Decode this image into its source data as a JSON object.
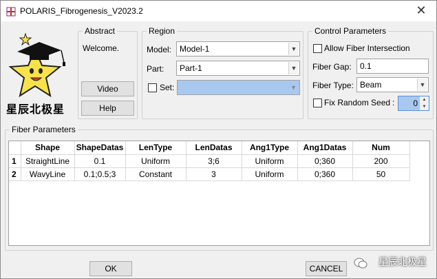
{
  "window": {
    "title": "POLARIS_Fibrogenesis_V2023.2"
  },
  "logo": {
    "caption": "星辰北极星"
  },
  "abstract": {
    "label": "Abstract",
    "welcome": "Welcome.",
    "video_button": "Video",
    "help_button": "Help"
  },
  "region": {
    "label": "Region",
    "model_label": "Model:",
    "model_value": "Model-1",
    "part_label": "Part:",
    "part_value": "Part-1",
    "set_label": "Set:",
    "set_checked": false
  },
  "control": {
    "label": "Control Parameters",
    "allow_intersection_label": "Allow Fiber Intersection",
    "allow_intersection_checked": false,
    "fiber_gap_label": "Fiber Gap:",
    "fiber_gap_value": "0.1",
    "fiber_type_label": "Fiber Type:",
    "fiber_type_value": "Beam",
    "fix_seed_label": "Fix Random Seed",
    "seed_sep": ":",
    "seed_value": "0"
  },
  "fiber_params": {
    "label": "Fiber Parameters",
    "headers": [
      "Shape",
      "ShapeDatas",
      "LenType",
      "LenDatas",
      "Ang1Type",
      "Ang1Datas",
      "Num"
    ],
    "rows": [
      {
        "index": "1",
        "cells": [
          "StraightLine",
          "0.1",
          "Uniform",
          "3;6",
          "Uniform",
          "0;360",
          "200"
        ]
      },
      {
        "index": "2",
        "cells": [
          "WavyLine",
          "0.1;0.5;3",
          "Constant",
          "3",
          "Uniform",
          "0;360",
          "50"
        ]
      }
    ]
  },
  "footer": {
    "ok_button": "OK",
    "cancel_button": "CANCEL"
  },
  "watermark": {
    "text": "星辰北极星"
  }
}
